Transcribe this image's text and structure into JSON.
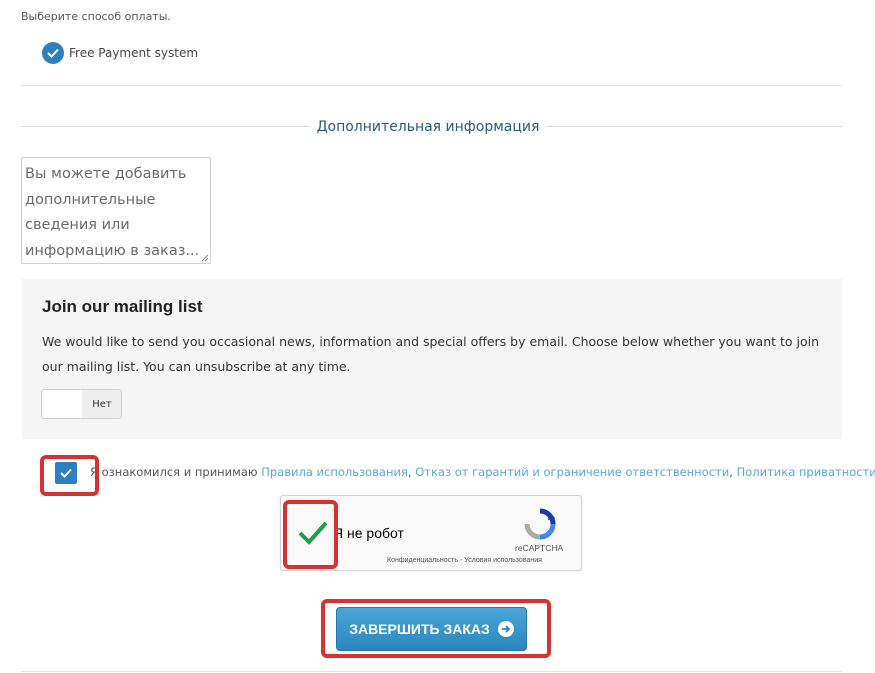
{
  "payment": {
    "title": "Выберите способ оплаты.",
    "option_label": "Free Payment system"
  },
  "additional": {
    "title": "Дополнительная информация",
    "placeholder": "Вы можете добавить дополнительные сведения или информацию в заказ..."
  },
  "mailing": {
    "title": "Join our mailing list",
    "text": "We would like to send you occasional news, information and special offers by email. Choose below whether you want to join our mailing list. You can unsubscribe at any time.",
    "toggle_value": "Нет"
  },
  "terms": {
    "prefix": "Я ознакомился и принимаю ",
    "link1": "Правила использования",
    "sep1": ", ",
    "link2": "Отказ от гарантий и ограничение ответственности",
    "sep2": ", ",
    "link3": "Политика приватности",
    "suffix": "."
  },
  "captcha": {
    "label": "Я не робот",
    "brand": "reCAPTCHA",
    "links": "Конфиденциальность - Условия использования"
  },
  "submit": {
    "label": "ЗАВЕРШИТЬ ЗАКАЗ"
  },
  "colors": {
    "accent": "#2c7fc0",
    "link": "#58a8d5",
    "highlight": "#d63232",
    "captcha_check": "#1e9e4a"
  }
}
